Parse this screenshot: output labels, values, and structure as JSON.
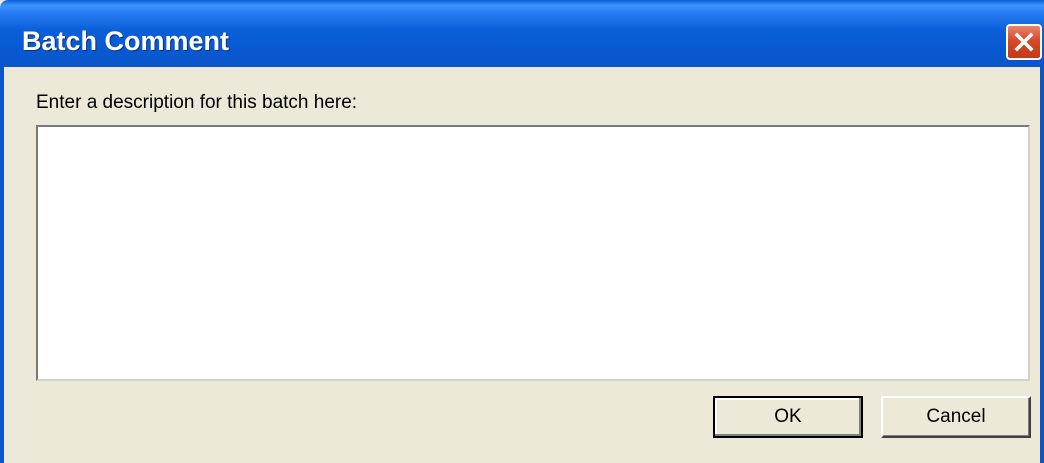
{
  "window": {
    "title": "Batch Comment"
  },
  "form": {
    "prompt_label": "Enter a description for this batch here:",
    "description_value": "",
    "description_placeholder": ""
  },
  "buttons": {
    "ok_label": "OK",
    "cancel_label": "Cancel"
  },
  "icons": {
    "close": "close-icon"
  },
  "colors": {
    "titlebar": "#0a5fd8",
    "dialog_background": "#ece9d8",
    "close_button": "#d8492a"
  }
}
